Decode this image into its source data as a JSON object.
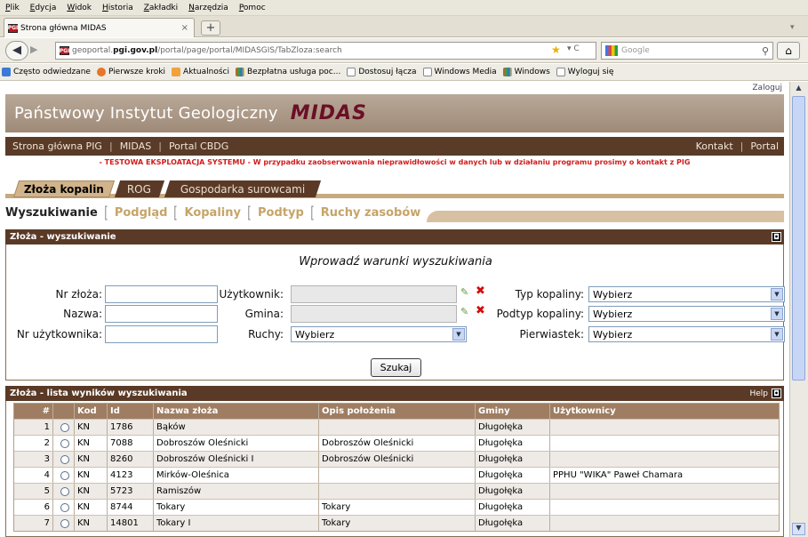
{
  "browser": {
    "menu": [
      "Plik",
      "Edycja",
      "Widok",
      "Historia",
      "Zakładki",
      "Narzędzia",
      "Pomoc"
    ],
    "tab_title": "Strona główna MIDAS",
    "favicon_text": "PGI",
    "new_tab": "+",
    "url_prefix": "geoportal.",
    "url_domain": "pgi.gov.pl",
    "url_path": "/portal/page/portal/MIDASGIS/TabZloza:search",
    "search_placeholder": "Google",
    "bookmarks": [
      "Często odwiedzane",
      "Pierwsze kroki",
      "Aktualności",
      "Bezpłatna usługa poc...",
      "Dostosuj łącza",
      "Windows Media",
      "Windows",
      "Wyloguj się"
    ]
  },
  "page": {
    "login": "Zaloguj",
    "org_name": "Państwowy Instytut Geologiczny",
    "app_name": "MIDAS",
    "topnav_left": [
      "Strona główna PIG",
      "MIDAS",
      "Portal CBDG"
    ],
    "topnav_right": [
      "Kontakt",
      "Portal"
    ],
    "warning": "- TESTOWA EKSPLOATACJA SYSTEMU - W przypadku zaobserwowania nieprawidłowości w danych lub w działaniu programu prosimy o kontakt z PIG",
    "main_tabs": [
      "Złoża kopalin",
      "ROG",
      "Gospodarka surowcami"
    ],
    "sub_tabs": [
      "Wyszukiwanie",
      "Podgląd",
      "Kopaliny",
      "Podtyp",
      "Ruchy zasobów"
    ]
  },
  "search_panel": {
    "title": "Złoża - wyszukiwanie",
    "form_title": "Wprowadź warunki wyszukiwania",
    "nr_zloza_label": "Nr złoża:",
    "nazwa_label": "Nazwa:",
    "nr_uzytkownika_label": "Nr użytkownika:",
    "uzytkownik_label": "Użytkownik:",
    "gmina_label": "Gmina:",
    "ruchy_label": "Ruchy:",
    "ruchy_value": "Wybierz",
    "typ_label": "Typ kopaliny:",
    "typ_value": "Wybierz",
    "podtyp_label": "Podtyp kopaliny:",
    "podtyp_value": "Wybierz",
    "pierwiastek_label": "Pierwiastek:",
    "pierwiastek_value": "Wybierz",
    "search_button": "Szukaj"
  },
  "results_panel": {
    "title": "Złoża - lista wyników wyszukiwania",
    "help": "Help",
    "columns": [
      "#",
      "",
      "Kod",
      "Id",
      "Nazwa złoża",
      "Opis położenia",
      "Gminy",
      "Użytkownicy"
    ],
    "rows": [
      [
        "1",
        "",
        "KN",
        "1786",
        "Bąków",
        "",
        "Długołęka",
        ""
      ],
      [
        "2",
        "",
        "KN",
        "7088",
        "Dobroszów Oleśnicki",
        "Dobroszów Oleśnicki",
        "Długołęka",
        ""
      ],
      [
        "3",
        "",
        "KN",
        "8260",
        "Dobroszów Oleśnicki I",
        "Dobroszów Oleśnicki",
        "Długołęka",
        ""
      ],
      [
        "4",
        "",
        "KN",
        "4123",
        "Mirków-Oleśnica",
        "",
        "Długołęka",
        "PPHU \"WIKA\" Paweł Chamara"
      ],
      [
        "5",
        "",
        "KN",
        "5723",
        "Ramiszów",
        "",
        "Długołęka",
        ""
      ],
      [
        "6",
        "",
        "KN",
        "8744",
        "Tokary",
        "Tokary",
        "Długołęka",
        ""
      ],
      [
        "7",
        "",
        "KN",
        "14801",
        "Tokary I",
        "Tokary",
        "Długołęka",
        ""
      ]
    ]
  }
}
